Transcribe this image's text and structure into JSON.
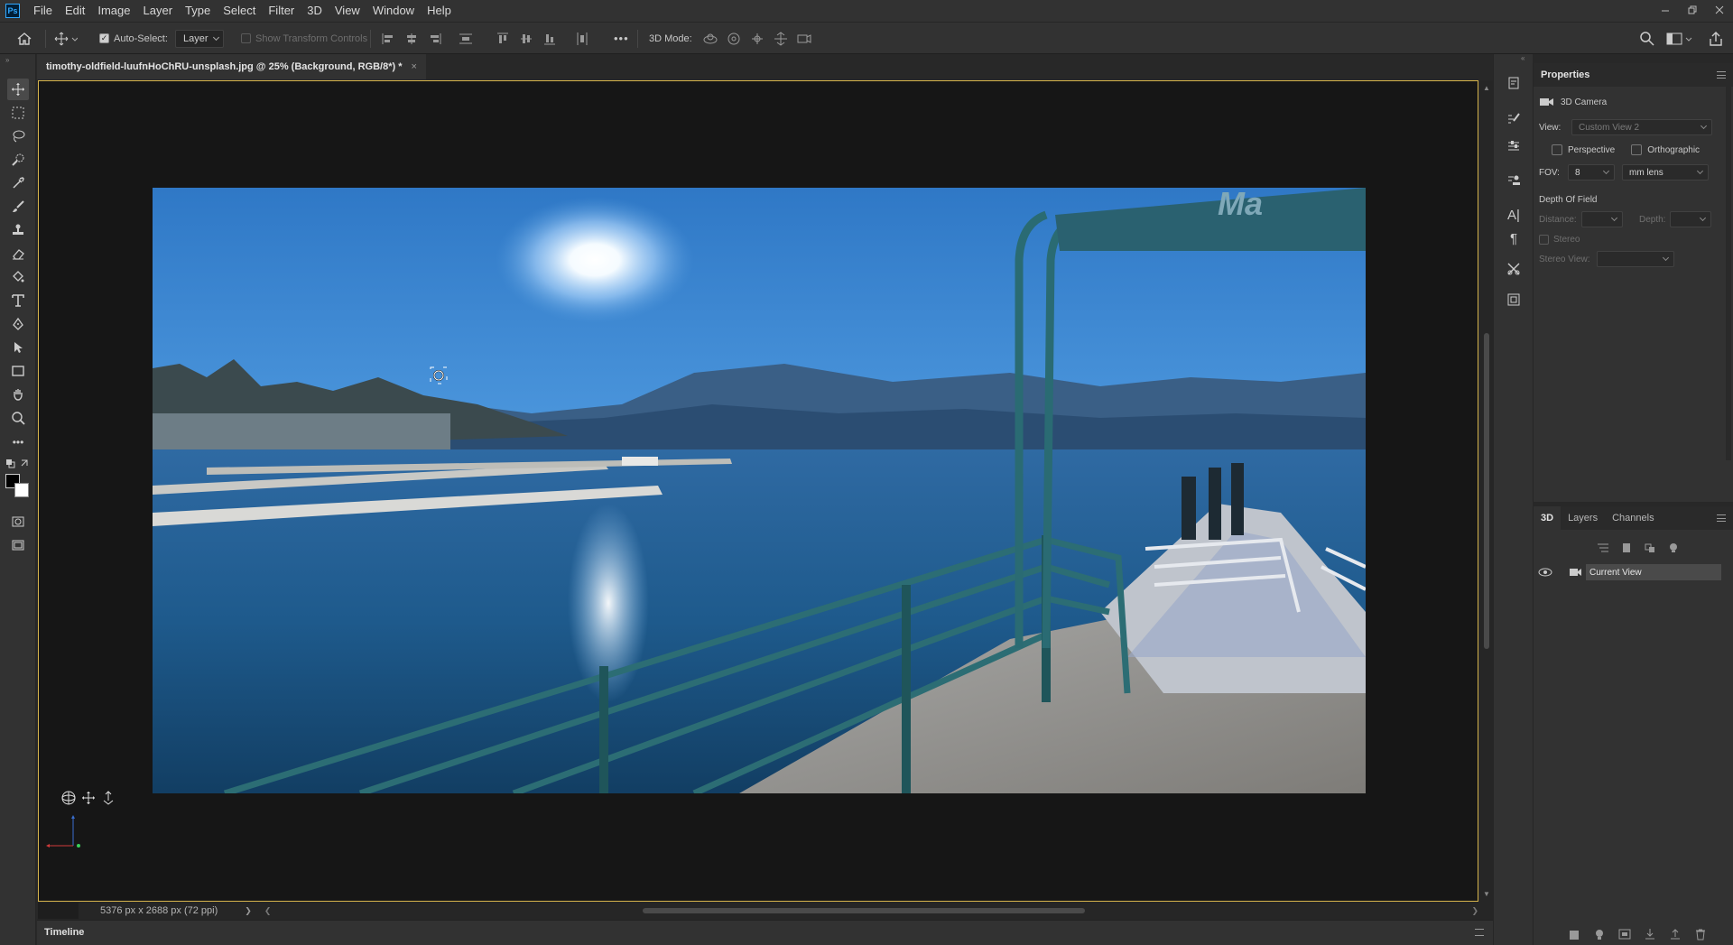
{
  "app": {
    "logo": "Ps",
    "menu": [
      "File",
      "Edit",
      "Image",
      "Layer",
      "Type",
      "Select",
      "Filter",
      "3D",
      "View",
      "Window",
      "Help"
    ],
    "window_controls": [
      "minimize-icon",
      "restore-icon",
      "close-icon"
    ]
  },
  "options": {
    "auto_select_label": "Auto-Select:",
    "auto_select_checked": true,
    "auto_select_target": "Layer",
    "show_transform_label": "Show Transform Controls",
    "more": "•••",
    "mode_3d_label": "3D Mode:"
  },
  "tools": [
    "move-icon",
    "marquee-icon",
    "lasso-icon",
    "quick-select-icon",
    "eyedropper-icon",
    "brush-icon",
    "stamp-icon",
    "eraser-icon",
    "paint-bucket-icon",
    "type-icon",
    "pen-icon",
    "path-select-icon",
    "rectangle-icon",
    "hand-icon",
    "zoom-icon",
    "more-tools-icon"
  ],
  "document": {
    "tab_title": "timothy-oldfield-luufnHoChRU-unsplash.jpg @ 25% (Background, RGB/8*) *",
    "close": "×"
  },
  "status": {
    "dimensions": "5376 px x 2688 px (72 ppi)",
    "next": "❯",
    "prev": "❮"
  },
  "timeline": {
    "label": "Timeline"
  },
  "properties": {
    "title": "Properties",
    "section": "3D Camera",
    "view_label": "View:",
    "view_value": "Custom View 2",
    "perspective": "Perspective",
    "orthographic": "Orthographic",
    "fov_label": "FOV:",
    "fov_value": "8",
    "fov_unit": "mm lens",
    "dof_label": "Depth Of Field",
    "distance_label": "Distance:",
    "depth_label": "Depth:",
    "stereo_label": "Stereo",
    "stereo_view_label": "Stereo View:"
  },
  "panel3d": {
    "tabs": [
      "3D",
      "Layers",
      "Channels"
    ],
    "current_view": "Current View"
  },
  "colors": {
    "accent_border": "#d6b44c",
    "panel_bg": "#323232",
    "canvas_bg": "#161616"
  }
}
